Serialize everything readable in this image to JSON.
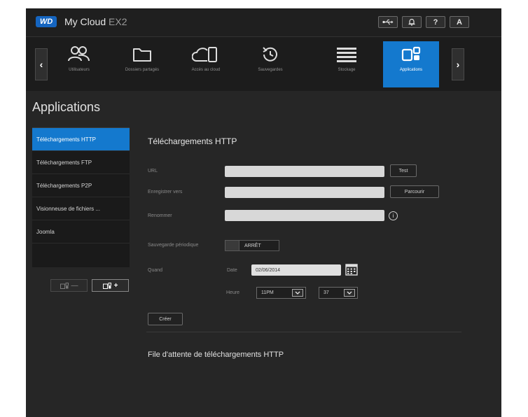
{
  "header": {
    "logo": "WD",
    "product": "My Cloud",
    "model": "EX2",
    "icons": [
      "usb-icon",
      "bell-icon",
      "help-icon",
      "user-icon"
    ],
    "help_glyph": "?",
    "user_glyph": "A"
  },
  "nav": {
    "prev_glyph": "‹",
    "next_glyph": "›",
    "items": [
      {
        "label": "Utilisateurs",
        "icon": "users-icon"
      },
      {
        "label": "Dossiers partagés",
        "icon": "folder-icon"
      },
      {
        "label": "Accès au cloud",
        "icon": "cloud-access-icon"
      },
      {
        "label": "Sauvegardes",
        "icon": "backup-icon"
      },
      {
        "label": "Stockage",
        "icon": "storage-icon"
      },
      {
        "label": "Applications",
        "icon": "applications-icon"
      }
    ],
    "active": "Applications"
  },
  "page": {
    "title": "Applications"
  },
  "sidebar": {
    "items": [
      {
        "label": "Téléchargements HTTP"
      },
      {
        "label": "Téléchargements FTP"
      },
      {
        "label": "Téléchargements P2P"
      },
      {
        "label": "Visionneuse de fichiers ..."
      },
      {
        "label": "Joomla"
      }
    ],
    "active_index": 0,
    "remove_glyph": "—",
    "add_glyph": "+"
  },
  "form": {
    "title": "Téléchargements HTTP",
    "url_label": "URL",
    "url_value": "",
    "test_button": "Test",
    "save_to_label": "Enregistrer vers",
    "save_to_value": "",
    "browse_button": "Parcourir",
    "rename_label": "Renommer",
    "rename_value": "",
    "info_glyph": "i",
    "periodic_label": "Sauvegarde périodique",
    "periodic_state": "ARRÊT",
    "when_label": "Quand",
    "date_label": "Date",
    "date_value": "02/06/2014",
    "time_label": "Heure",
    "hour_value": "11PM",
    "minute_value": "37",
    "create_button": "Créer"
  },
  "queue": {
    "title": "File d'attente de téléchargements HTTP"
  },
  "colors": {
    "accent": "#1479ce",
    "background": "#262626",
    "nav_background": "#1c1c1c"
  }
}
